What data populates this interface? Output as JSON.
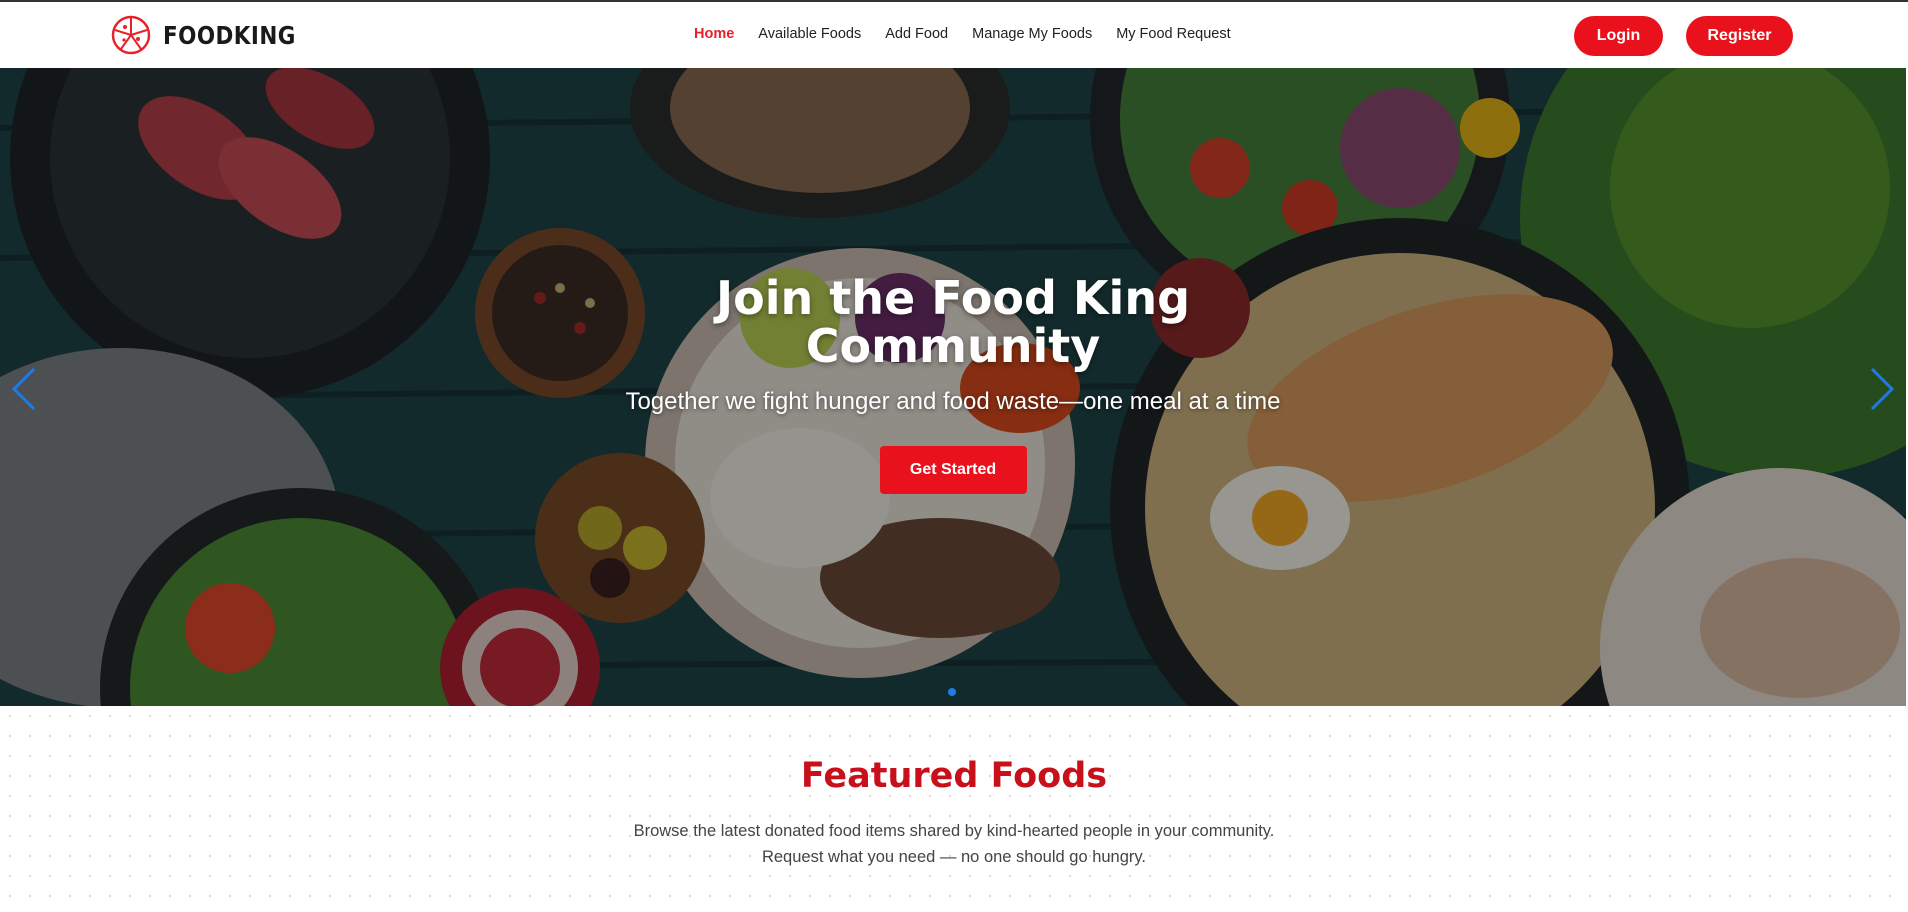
{
  "header": {
    "brand": "FOODKING",
    "nav": [
      {
        "label": "Home",
        "active": true
      },
      {
        "label": "Available Foods",
        "active": false
      },
      {
        "label": "Add Food",
        "active": false
      },
      {
        "label": "Manage My Foods",
        "active": false
      },
      {
        "label": "My Food Request",
        "active": false
      }
    ],
    "login_label": "Login",
    "register_label": "Register"
  },
  "hero": {
    "title": "Join the Food King Community",
    "subtitle": "Together we fight hunger and food waste—one meal at a time",
    "cta_label": "Get Started",
    "slide_count": 1,
    "active_slide": 1
  },
  "featured": {
    "title": "Featured Foods",
    "description": "Browse the latest donated food items shared by kind-hearted people in your community. Request what you need — no one should go hungry."
  },
  "colors": {
    "accent": "#e8111c",
    "active_nav": "#e8202a",
    "featured_title": "#c8101a",
    "carousel": "#1e7be6"
  },
  "icons": {
    "logo": "pizza-slice-icon",
    "prev": "chevron-left-icon",
    "next": "chevron-right-icon"
  }
}
